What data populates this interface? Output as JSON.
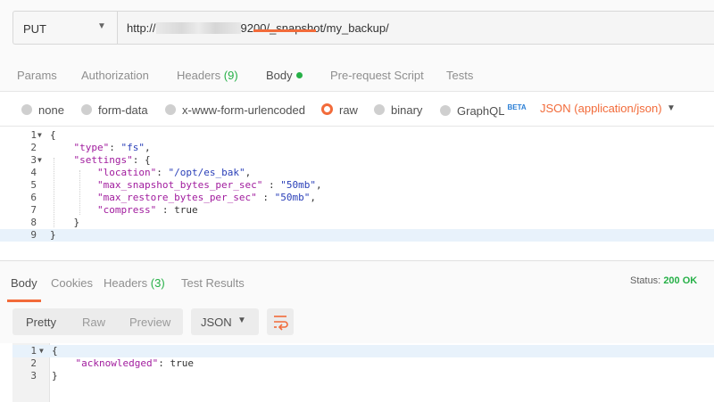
{
  "request": {
    "method": "PUT",
    "url_prefix": "http://",
    "url_suffix": "9200/_snapshot/my_backup/"
  },
  "request_tabs": [
    {
      "label": "Params"
    },
    {
      "label": "Authorization"
    },
    {
      "label": "Headers",
      "count": "(9)"
    },
    {
      "label": "Body"
    },
    {
      "label": "Pre-request Script"
    },
    {
      "label": "Tests"
    }
  ],
  "body_types": {
    "options": [
      "none",
      "form-data",
      "x-www-form-urlencoded",
      "raw",
      "binary",
      "GraphQL"
    ],
    "selected": "raw",
    "graphql_badge": "BETA",
    "content_type": "JSON (application/json)"
  },
  "request_body": {
    "line_numbers": [
      "1",
      "2",
      "3",
      "4",
      "5",
      "6",
      "7",
      "8",
      "9"
    ],
    "lines": [
      [
        {
          "t": "p",
          "v": "{"
        }
      ],
      [
        {
          "t": "p",
          "v": "    "
        },
        {
          "t": "k",
          "v": "\"type\""
        },
        {
          "t": "p",
          "v": ": "
        },
        {
          "t": "s",
          "v": "\"fs\""
        },
        {
          "t": "p",
          "v": ","
        }
      ],
      [
        {
          "t": "p",
          "v": "    "
        },
        {
          "t": "k",
          "v": "\"settings\""
        },
        {
          "t": "p",
          "v": ": {"
        }
      ],
      [
        {
          "t": "p",
          "v": "        "
        },
        {
          "t": "k",
          "v": "\"location\""
        },
        {
          "t": "p",
          "v": ": "
        },
        {
          "t": "s",
          "v": "\"/opt/es_bak\""
        },
        {
          "t": "p",
          "v": ","
        }
      ],
      [
        {
          "t": "p",
          "v": "        "
        },
        {
          "t": "k",
          "v": "\"max_snapshot_bytes_per_sec\""
        },
        {
          "t": "p",
          "v": " : "
        },
        {
          "t": "s",
          "v": "\"50mb\""
        },
        {
          "t": "p",
          "v": ","
        }
      ],
      [
        {
          "t": "p",
          "v": "        "
        },
        {
          "t": "k",
          "v": "\"max_restore_bytes_per_sec\""
        },
        {
          "t": "p",
          "v": " : "
        },
        {
          "t": "s",
          "v": "\"50mb\""
        },
        {
          "t": "p",
          "v": ","
        }
      ],
      [
        {
          "t": "p",
          "v": "        "
        },
        {
          "t": "k",
          "v": "\"compress\""
        },
        {
          "t": "p",
          "v": " : true"
        }
      ],
      [
        {
          "t": "p",
          "v": "    }"
        }
      ],
      [
        {
          "t": "p",
          "v": "}"
        }
      ]
    ]
  },
  "response": {
    "tabs": [
      {
        "label": "Body"
      },
      {
        "label": "Cookies"
      },
      {
        "label": "Headers",
        "count": "(3)"
      },
      {
        "label": "Test Results"
      }
    ],
    "status_label": "Status:",
    "status_value": "200 OK",
    "view_modes": [
      "Pretty",
      "Raw",
      "Preview"
    ],
    "format": "JSON",
    "line_numbers": [
      "1",
      "2",
      "3"
    ],
    "lines": [
      [
        {
          "t": "p",
          "v": "{"
        }
      ],
      [
        {
          "t": "p",
          "v": "    "
        },
        {
          "t": "k",
          "v": "\"acknowledged\""
        },
        {
          "t": "p",
          "v": ": true"
        }
      ],
      [
        {
          "t": "p",
          "v": "}"
        }
      ]
    ]
  },
  "colors": {
    "accent": "#f26b3a",
    "success": "#26b047",
    "json_key": "#a11c9e",
    "json_string": "#2a3fb8"
  }
}
